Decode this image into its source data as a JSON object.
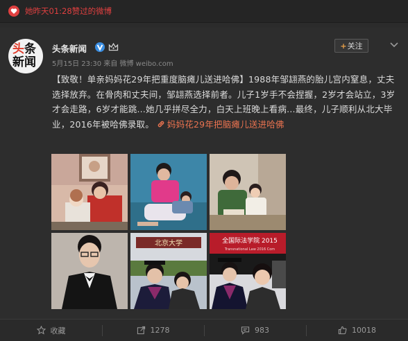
{
  "notice": {
    "text": "她昨天01:28赞过的微博"
  },
  "post": {
    "author": "头条新闻",
    "avatar_text_1a": "头",
    "avatar_text_1b": "条",
    "avatar_text_2": "新闻",
    "timestamp": "5月15日 23:30",
    "source": "来自 微博 weibo.com",
    "follow_plus": "+",
    "follow_label": "关注",
    "body_text": "【致敬！单亲妈妈花29年把重度脑瘫儿送进哈佛】1988年邹翃燕的胎儿宫内窒息，丈夫选择放弃。在骨肉和丈夫间，邹翃燕选择前者。儿子1岁手不会捏握，2岁才会站立，3岁才会走路，6岁才能跳...她几乎拼尽全力，白天上班晚上看病...最终，儿子顺利从北大毕业，2016年被哈佛录取。",
    "link_text": "妈妈花29年把脑瘫儿送进哈佛"
  },
  "photo_texts": {
    "sign_1": "北京大学",
    "banner": "全国际法学院 2015",
    "banner_sub": "Transnational Law 2016 Com"
  },
  "actions": [
    {
      "icon": "star-icon",
      "label": "收藏"
    },
    {
      "icon": "share-icon",
      "label": "1278"
    },
    {
      "icon": "comment-icon",
      "label": "983"
    },
    {
      "icon": "thumb-up-icon",
      "label": "10018"
    }
  ],
  "colors": {
    "accent": "#eb7350",
    "notice": "#e04040",
    "vip": "#3a8de0"
  }
}
